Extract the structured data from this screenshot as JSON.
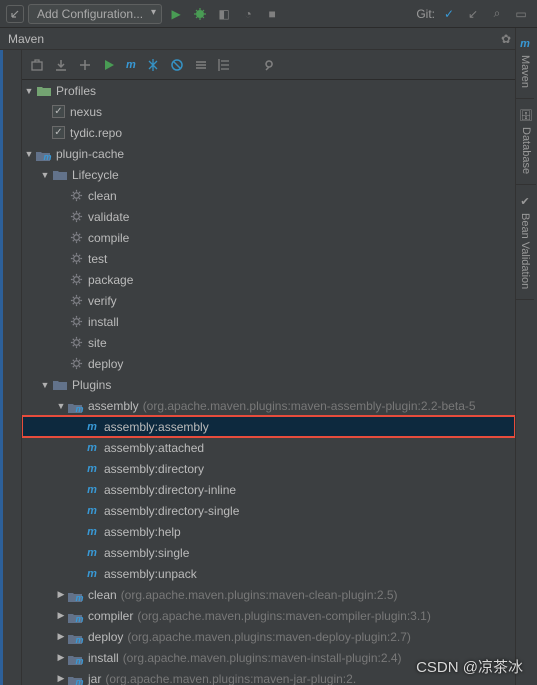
{
  "toolbar": {
    "run_config": "Add Configuration...",
    "git_label": "Git:"
  },
  "panel": {
    "title": "Maven"
  },
  "right_tabs": [
    "Maven",
    "Database",
    "Bean Validation"
  ],
  "tree": {
    "profiles": {
      "label": "Profiles",
      "items": [
        {
          "label": "nexus",
          "checked": true
        },
        {
          "label": "tydic.repo",
          "checked": true
        }
      ]
    },
    "project": {
      "label": "plugin-cache",
      "lifecycle": {
        "label": "Lifecycle",
        "phases": [
          "clean",
          "validate",
          "compile",
          "test",
          "package",
          "verify",
          "install",
          "site",
          "deploy"
        ]
      },
      "plugins": {
        "label": "Plugins",
        "expanded": {
          "label": "assembly",
          "sub": "(org.apache.maven.plugins:maven-assembly-plugin:2.2-beta-5",
          "goals": [
            "assembly:assembly",
            "assembly:attached",
            "assembly:directory",
            "assembly:directory-inline",
            "assembly:directory-single",
            "assembly:help",
            "assembly:single",
            "assembly:unpack"
          ]
        },
        "collapsed": [
          {
            "label": "clean",
            "sub": "(org.apache.maven.plugins:maven-clean-plugin:2.5)"
          },
          {
            "label": "compiler",
            "sub": "(org.apache.maven.plugins:maven-compiler-plugin:3.1)"
          },
          {
            "label": "deploy",
            "sub": "(org.apache.maven.plugins:maven-deploy-plugin:2.7)"
          },
          {
            "label": "install",
            "sub": "(org.apache.maven.plugins:maven-install-plugin:2.4)"
          },
          {
            "label": "jar",
            "sub": "(org.apache.maven.plugins:maven-jar-plugin:2."
          }
        ]
      }
    }
  },
  "watermark": "CSDN @凉茶冰"
}
